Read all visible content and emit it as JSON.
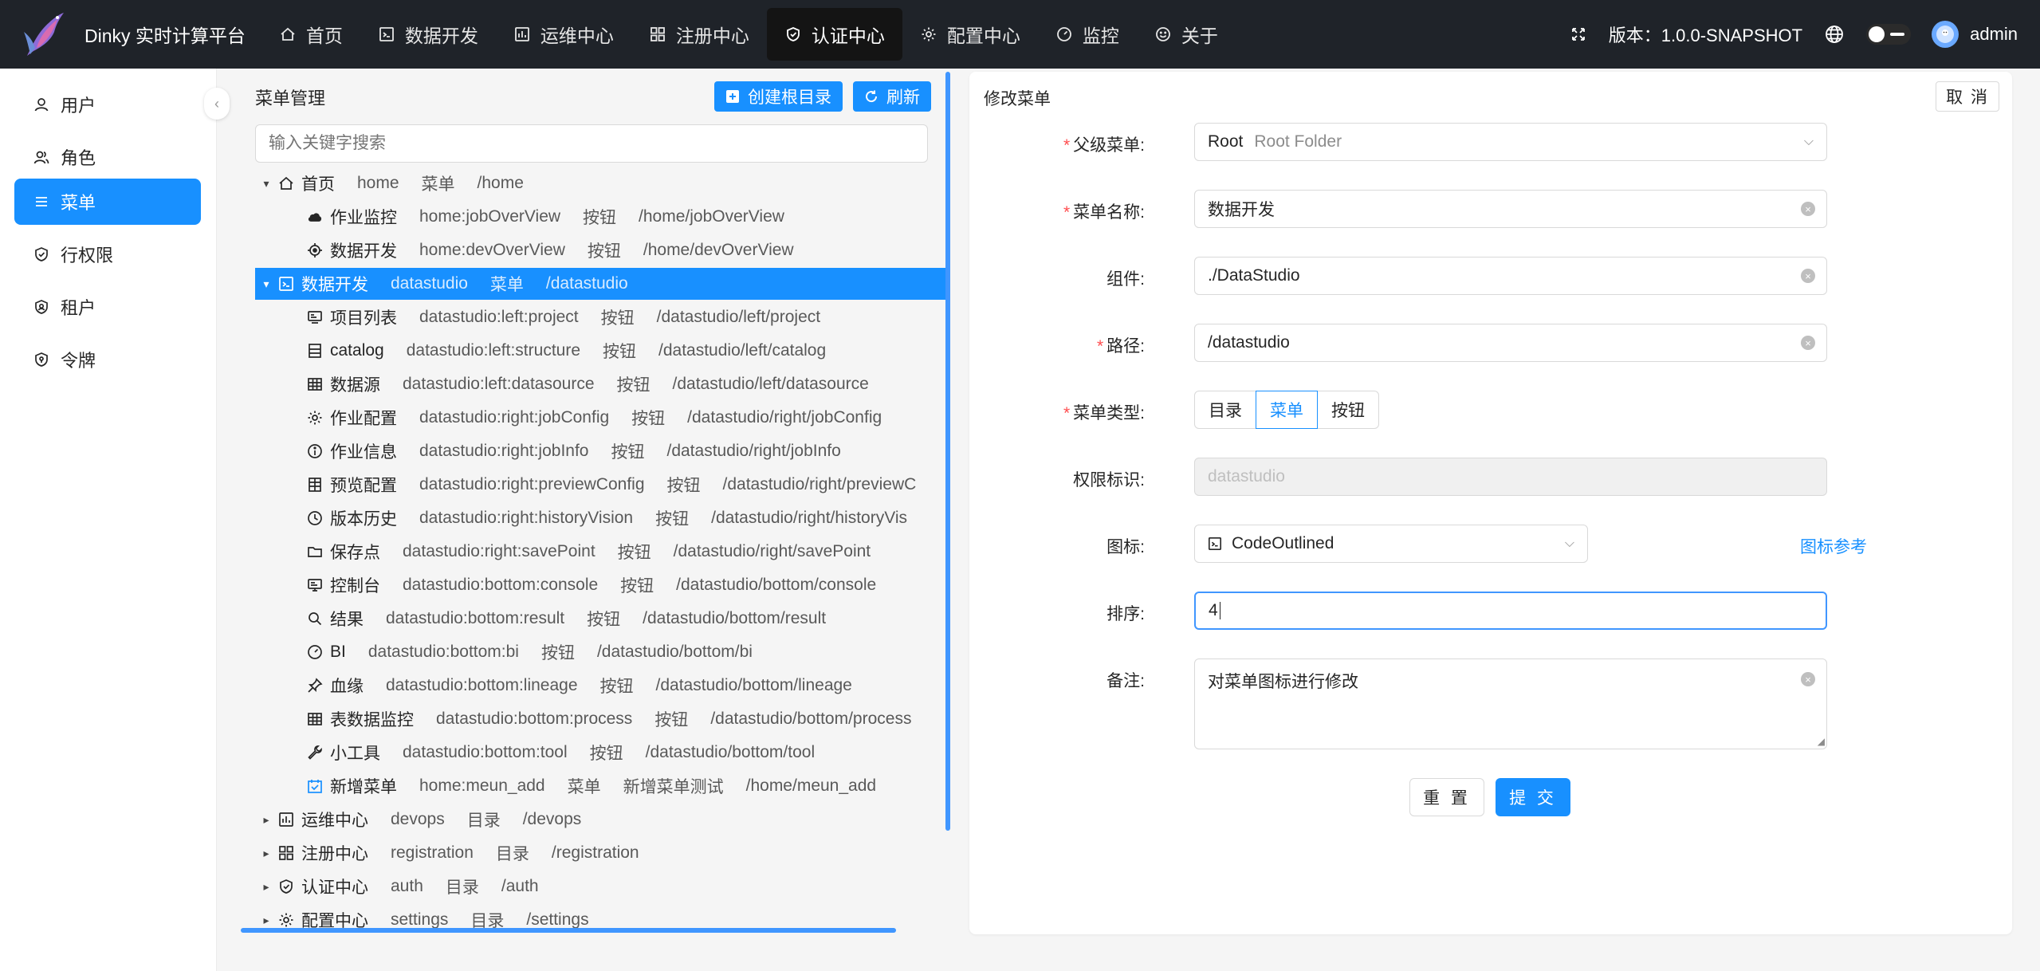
{
  "header": {
    "brand": "Dinky 实时计算平台",
    "nav": [
      {
        "label": "首页",
        "icon": "home-icon"
      },
      {
        "label": "数据开发",
        "icon": "code-icon"
      },
      {
        "label": "运维中心",
        "icon": "fund-icon"
      },
      {
        "label": "注册中心",
        "icon": "appstore-icon"
      },
      {
        "label": "认证中心",
        "icon": "safety-icon"
      },
      {
        "label": "配置中心",
        "icon": "setting-icon"
      },
      {
        "label": "监控",
        "icon": "dashboard-icon"
      },
      {
        "label": "关于",
        "icon": "smile-icon"
      }
    ],
    "active_nav": "认证中心",
    "version": "版本：1.0.0-SNAPSHOT",
    "user": "admin"
  },
  "sidebar": {
    "items": [
      {
        "label": "用户",
        "icon": "user-icon"
      },
      {
        "label": "角色",
        "icon": "team-icon"
      },
      {
        "label": "菜单",
        "icon": "menu-icon"
      },
      {
        "label": "行权限",
        "icon": "safety-icon"
      },
      {
        "label": "租户",
        "icon": "tenant-icon"
      },
      {
        "label": "令牌",
        "icon": "token-icon"
      }
    ],
    "active": "菜单"
  },
  "tree_panel": {
    "title": "菜单管理",
    "create_root_label": "创建根目录",
    "refresh_label": "刷新",
    "search_placeholder": "输入关键字搜索",
    "rows": [
      {
        "level": 0,
        "expand": "open",
        "icon": "home-icon",
        "name": "首页",
        "key": "home",
        "type": "菜单",
        "note": "",
        "path": "/home"
      },
      {
        "level": 1,
        "icon": "cloud-icon",
        "name": "作业监控",
        "key": "home:jobOverView",
        "type": "按钮",
        "note": "",
        "path": "/home/jobOverView"
      },
      {
        "level": 1,
        "icon": "aim-icon",
        "name": "数据开发",
        "key": "home:devOverView",
        "type": "按钮",
        "note": "",
        "path": "/home/devOverView"
      },
      {
        "level": 0,
        "expand": "open",
        "icon": "code-icon",
        "name": "数据开发",
        "key": "datastudio",
        "type": "菜单",
        "note": "",
        "path": "/datastudio",
        "selected": true
      },
      {
        "level": 1,
        "icon": "project-icon",
        "name": "项目列表",
        "key": "datastudio:left:project",
        "type": "按钮",
        "note": "",
        "path": "/datastudio/left/project"
      },
      {
        "level": 1,
        "icon": "catalog-icon",
        "name": "catalog",
        "key": "datastudio:left:structure",
        "type": "按钮",
        "note": "",
        "path": "/datastudio/left/catalog"
      },
      {
        "level": 1,
        "icon": "table-icon",
        "name": "数据源",
        "key": "datastudio:left:datasource",
        "type": "按钮",
        "note": "",
        "path": "/datastudio/left/datasource"
      },
      {
        "level": 1,
        "icon": "setting-icon",
        "name": "作业配置",
        "key": "datastudio:right:jobConfig",
        "type": "按钮",
        "note": "",
        "path": "/datastudio/right/jobConfig"
      },
      {
        "level": 1,
        "icon": "info-icon",
        "name": "作业信息",
        "key": "datastudio:right:jobInfo",
        "type": "按钮",
        "note": "",
        "path": "/datastudio/right/jobInfo"
      },
      {
        "level": 1,
        "icon": "insert-row-icon",
        "name": "预览配置",
        "key": "datastudio:right:previewConfig",
        "type": "按钮",
        "note": "",
        "path": "/datastudio/right/previewC"
      },
      {
        "level": 1,
        "icon": "history-icon",
        "name": "版本历史",
        "key": "datastudio:right:historyVision",
        "type": "按钮",
        "note": "",
        "path": "/datastudio/right/historyVis"
      },
      {
        "level": 1,
        "icon": "folder-icon",
        "name": "保存点",
        "key": "datastudio:right:savePoint",
        "type": "按钮",
        "note": "",
        "path": "/datastudio/right/savePoint"
      },
      {
        "level": 1,
        "icon": "desktop-icon",
        "name": "控制台",
        "key": "datastudio:bottom:console",
        "type": "按钮",
        "note": "",
        "path": "/datastudio/bottom/console"
      },
      {
        "level": 1,
        "icon": "search-icon",
        "name": "结果",
        "key": "datastudio:bottom:result",
        "type": "按钮",
        "note": "",
        "path": "/datastudio/bottom/result"
      },
      {
        "level": 1,
        "icon": "dashboard-icon",
        "name": "BI",
        "key": "datastudio:bottom:bi",
        "type": "按钮",
        "note": "",
        "path": "/datastudio/bottom/bi"
      },
      {
        "level": 1,
        "icon": "pushpin-icon",
        "name": "血缘",
        "key": "datastudio:bottom:lineage",
        "type": "按钮",
        "note": "",
        "path": "/datastudio/bottom/lineage"
      },
      {
        "level": 1,
        "icon": "table-icon",
        "name": "表数据监控",
        "key": "datastudio:bottom:process",
        "type": "按钮",
        "note": "",
        "path": "/datastudio/bottom/process"
      },
      {
        "level": 1,
        "icon": "tool-icon",
        "name": "小工具",
        "key": "datastudio:bottom:tool",
        "type": "按钮",
        "note": "",
        "path": "/datastudio/bottom/tool"
      },
      {
        "level": 1,
        "icon": "schedule-icon",
        "name": "新增菜单",
        "key": "home:meun_add",
        "type": "菜单",
        "note": "新增菜单测试",
        "path": "/home/meun_add"
      },
      {
        "level": 0,
        "expand": "closed",
        "icon": "fund-icon",
        "name": "运维中心",
        "key": "devops",
        "type": "目录",
        "note": "",
        "path": "/devops"
      },
      {
        "level": 0,
        "expand": "closed",
        "icon": "appstore-icon",
        "name": "注册中心",
        "key": "registration",
        "type": "目录",
        "note": "",
        "path": "/registration"
      },
      {
        "level": 0,
        "expand": "closed",
        "icon": "safety-icon",
        "name": "认证中心",
        "key": "auth",
        "type": "目录",
        "note": "",
        "path": "/auth"
      },
      {
        "level": 0,
        "expand": "closed",
        "icon": "setting-icon",
        "name": "配置中心",
        "key": "settings",
        "type": "目录",
        "note": "",
        "path": "/settings"
      }
    ]
  },
  "form": {
    "title": "修改菜单",
    "cancel_label": "取 消",
    "parent_label": "父级菜单:",
    "parent_value": "Root",
    "parent_hint": "Root Folder",
    "name_label": "菜单名称:",
    "name_value": "数据开发",
    "component_label": "组件:",
    "component_value": "./DataStudio",
    "path_label": "路径:",
    "path_value": "/datastudio",
    "type_label": "菜单类型:",
    "type_options": [
      "目录",
      "菜单",
      "按钮"
    ],
    "type_selected": "菜单",
    "perm_label": "权限标识:",
    "perm_value": "datastudio",
    "icon_label": "图标:",
    "icon_value": "CodeOutlined",
    "icon_ref_label": "图标参考",
    "order_label": "排序:",
    "order_value": "4",
    "note_label": "备注:",
    "note_value": "对菜单图标进行修改",
    "reset_label": "重 置",
    "submit_label": "提 交"
  },
  "colors": {
    "primary": "#1890ff",
    "header_bg": "#1f2329",
    "required": "#ff4d4f"
  }
}
